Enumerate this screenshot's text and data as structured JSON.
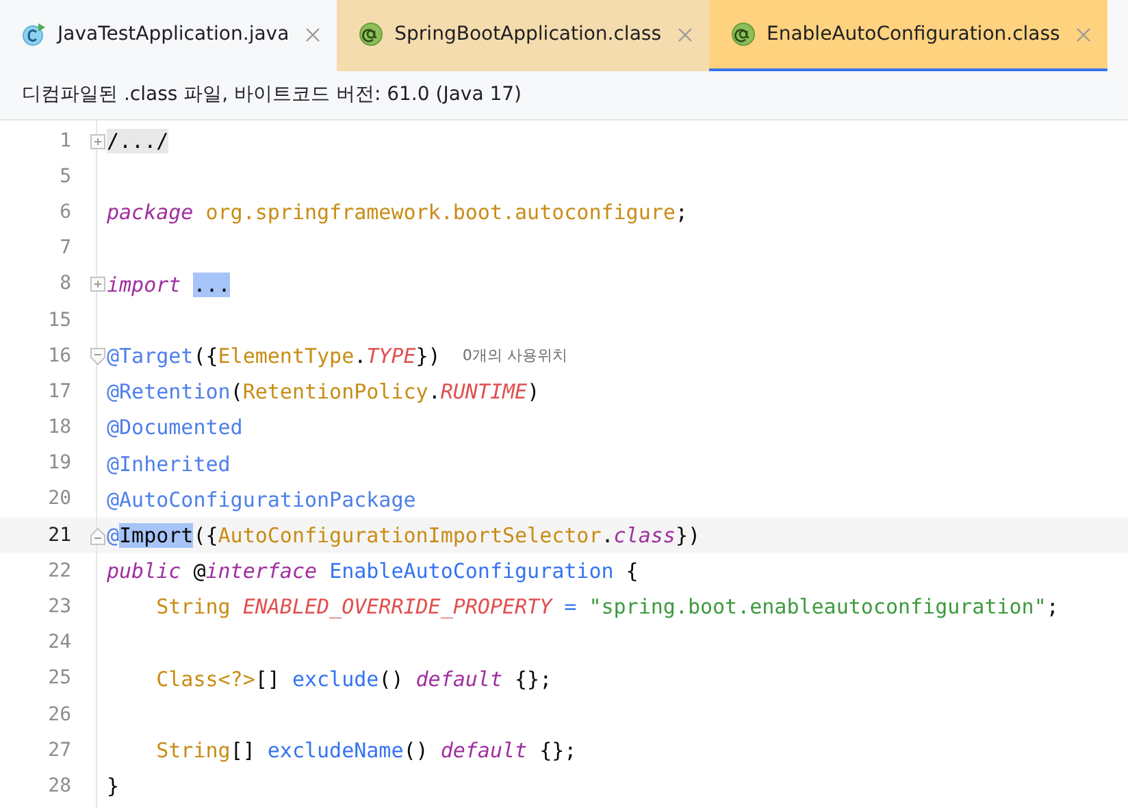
{
  "tabs": [
    {
      "label": "JavaTestApplication.java",
      "kind": "class",
      "color": "#f7f8fa",
      "selected": false
    },
    {
      "label": "SpringBootApplication.class",
      "kind": "annotation",
      "color": "#f5dcae",
      "selected": false
    },
    {
      "label": "EnableAutoConfiguration.class",
      "kind": "annotation",
      "color": "#ffd27f",
      "selected": true
    }
  ],
  "banner": "디컴파일된 .class 파일, 바이트코드 버전: 61.0 (Java 17)",
  "lines": [
    {
      "number": "1",
      "current": false,
      "fold": {
        "kind": "expand"
      },
      "tokens": [
        {
          "text": "/.../",
          "kind": "folded",
          "selected": false
        }
      ]
    },
    {
      "number": "5",
      "current": false
    },
    {
      "number": "6",
      "current": false,
      "tokens": [
        {
          "text": "package ",
          "kind": "keyword",
          "selected": false
        },
        {
          "text": "org.springframework.boot.autoconfigure",
          "kind": "type",
          "selected": false
        },
        {
          "text": ";",
          "kind": "plain",
          "selected": false
        }
      ]
    },
    {
      "number": "7",
      "current": false
    },
    {
      "number": "8",
      "current": false,
      "fold": {
        "kind": "expand"
      },
      "tokens": [
        {
          "text": "import ",
          "kind": "keyword",
          "selected": false
        },
        {
          "text": "...",
          "kind": "plain",
          "selected": true
        }
      ]
    },
    {
      "number": "15",
      "current": false
    },
    {
      "number": "16",
      "current": false,
      "fold": {
        "kind": "collapse"
      },
      "hint": "0개의 사용위치",
      "tokens": [
        {
          "text": "@Target",
          "kind": "annotation",
          "selected": false
        },
        {
          "text": "({",
          "kind": "plain",
          "selected": false
        },
        {
          "text": "ElementType",
          "kind": "type",
          "selected": false
        },
        {
          "text": ".",
          "kind": "plain",
          "selected": false
        },
        {
          "text": "TYPE",
          "kind": "constant",
          "selected": false
        },
        {
          "text": "})",
          "kind": "plain",
          "selected": false
        }
      ]
    },
    {
      "number": "17",
      "current": false,
      "tokens": [
        {
          "text": "@Retention",
          "kind": "annotation",
          "selected": false
        },
        {
          "text": "(",
          "kind": "plain",
          "selected": false
        },
        {
          "text": "RetentionPolicy",
          "kind": "type",
          "selected": false
        },
        {
          "text": ".",
          "kind": "plain",
          "selected": false
        },
        {
          "text": "RUNTIME",
          "kind": "constant",
          "selected": false
        },
        {
          "text": ")",
          "kind": "plain",
          "selected": false
        }
      ]
    },
    {
      "number": "18",
      "current": false,
      "tokens": [
        {
          "text": "@Documented",
          "kind": "annotation",
          "selected": false
        }
      ]
    },
    {
      "number": "19",
      "current": false,
      "tokens": [
        {
          "text": "@Inherited",
          "kind": "annotation",
          "selected": false
        }
      ]
    },
    {
      "number": "20",
      "current": false,
      "tokens": [
        {
          "text": "@AutoConfigurationPackage",
          "kind": "annotation",
          "selected": false
        }
      ]
    },
    {
      "number": "21",
      "current": true,
      "fold": {
        "kind": "end"
      },
      "tokens": [
        {
          "text": "@",
          "kind": "annotation",
          "selected": false
        },
        {
          "text": "Import",
          "kind": "plain",
          "selected": true
        },
        {
          "text": "({",
          "kind": "plain",
          "selected": false
        },
        {
          "text": "AutoConfigurationImportSelector",
          "kind": "type",
          "selected": false
        },
        {
          "text": ".",
          "kind": "plain",
          "selected": false
        },
        {
          "text": "class",
          "kind": "keyword",
          "selected": false
        },
        {
          "text": "})",
          "kind": "plain",
          "selected": false
        }
      ]
    },
    {
      "number": "22",
      "current": false,
      "tokens": [
        {
          "text": "public ",
          "kind": "keyword",
          "selected": false
        },
        {
          "text": "@",
          "kind": "plain",
          "selected": false
        },
        {
          "text": "interface ",
          "kind": "keyword",
          "selected": false
        },
        {
          "text": "EnableAutoConfiguration",
          "kind": "method",
          "selected": false
        },
        {
          "text": " {",
          "kind": "plain",
          "selected": false
        }
      ]
    },
    {
      "number": "23",
      "current": false,
      "tokens": [
        {
          "text": "    String ",
          "kind": "type",
          "selected": false
        },
        {
          "text": "ENABLED_OVERRIDE_PROPERTY",
          "kind": "constant",
          "selected": false
        },
        {
          "text": " = ",
          "kind": "method",
          "selected": false
        },
        {
          "text": "\"spring.boot.enableautoconfiguration\"",
          "kind": "string",
          "selected": false
        },
        {
          "text": ";",
          "kind": "plain",
          "selected": false
        }
      ]
    },
    {
      "number": "24",
      "current": false
    },
    {
      "number": "25",
      "current": false,
      "tokens": [
        {
          "text": "    Class<?>",
          "kind": "type",
          "selected": false
        },
        {
          "text": "[] ",
          "kind": "plain",
          "selected": false
        },
        {
          "text": "exclude",
          "kind": "method",
          "selected": false
        },
        {
          "text": "() ",
          "kind": "plain",
          "selected": false
        },
        {
          "text": "default",
          "kind": "keyword",
          "selected": false
        },
        {
          "text": " {};",
          "kind": "plain",
          "selected": false
        }
      ]
    },
    {
      "number": "26",
      "current": false
    },
    {
      "number": "27",
      "current": false,
      "tokens": [
        {
          "text": "    String",
          "kind": "type",
          "selected": false
        },
        {
          "text": "[] ",
          "kind": "plain",
          "selected": false
        },
        {
          "text": "excludeName",
          "kind": "method",
          "selected": false
        },
        {
          "text": "() ",
          "kind": "plain",
          "selected": false
        },
        {
          "text": "default",
          "kind": "keyword",
          "selected": false
        },
        {
          "text": " {};",
          "kind": "plain",
          "selected": false
        }
      ]
    },
    {
      "number": "28",
      "current": false,
      "tokens": [
        {
          "text": "}",
          "kind": "plain",
          "selected": false
        }
      ]
    }
  ]
}
